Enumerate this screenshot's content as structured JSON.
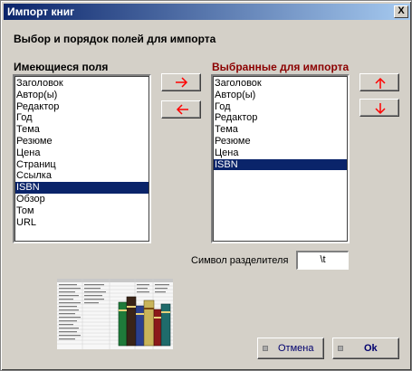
{
  "window": {
    "title": "Импорт книг",
    "close_label": "X"
  },
  "heading": "Выбор и порядок полей для импорта",
  "available": {
    "label": "Имеющиеся поля",
    "items": [
      "Заголовок",
      "Автор(ы)",
      "Редактор",
      "Год",
      "Тема",
      "Резюме",
      "Цена",
      "Страниц",
      "Ссылка",
      "ISBN",
      "Обзор",
      "Том",
      "URL"
    ],
    "selected_index": 9
  },
  "selected": {
    "label": "Выбранные для импорта",
    "items": [
      "Заголовок",
      "Автор(ы)",
      "Год",
      "Редактор",
      "Тема",
      "Резюме",
      "Цена",
      "ISBN"
    ],
    "selected_index": 7
  },
  "controls": {
    "add_icon": "arrow-right-icon",
    "remove_icon": "arrow-left-icon",
    "move_up_icon": "arrow-up-icon",
    "move_down_icon": "arrow-down-icon",
    "arrow_color": "#ff0000"
  },
  "separator": {
    "label": "Символ разделителя",
    "value": "\\t"
  },
  "buttons": {
    "cancel": "Отмена",
    "ok": "Ok"
  },
  "colors": {
    "title_bar_start": "#0a246a",
    "title_bar_end": "#a6caf0",
    "selection": "#0a246a",
    "selected_label": "#8b0000"
  }
}
